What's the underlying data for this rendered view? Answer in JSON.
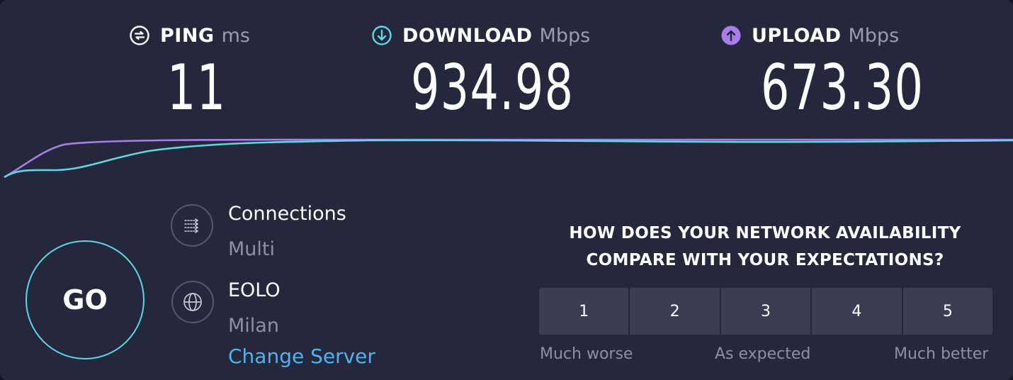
{
  "metrics": {
    "ping": {
      "label": "PING",
      "unit": "ms",
      "value": "11",
      "icon": "ping-icon"
    },
    "download": {
      "label": "DOWNLOAD",
      "unit": "Mbps",
      "value": "934.98",
      "icon": "download-arrow-icon",
      "color": "#5fd6e3"
    },
    "upload": {
      "label": "UPLOAD",
      "unit": "Mbps",
      "value": "673.30",
      "icon": "upload-arrow-icon",
      "color": "#a87fe9"
    }
  },
  "go": {
    "label": "GO"
  },
  "connections": {
    "title": "Connections",
    "value": "Multi",
    "icon": "connections-icon"
  },
  "server": {
    "provider": "EOLO",
    "location": "Milan",
    "change_label": "Change Server",
    "icon": "globe-icon"
  },
  "survey": {
    "question_line1": "HOW DOES YOUR NETWORK AVAILABILITY",
    "question_line2": "COMPARE WITH YOUR EXPECTATIONS?",
    "options": [
      "1",
      "2",
      "3",
      "4",
      "5"
    ],
    "label_low": "Much worse",
    "label_mid": "As expected",
    "label_high": "Much better"
  },
  "colors": {
    "background": "#25273c",
    "download": "#5fd6e3",
    "upload": "#a87fe9",
    "link": "#4fb3ee"
  }
}
